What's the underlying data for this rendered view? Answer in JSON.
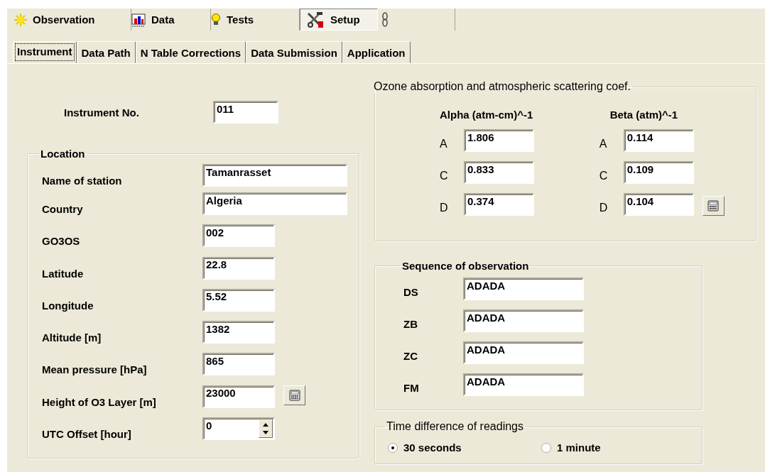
{
  "top_tabs": [
    {
      "label": "Observation",
      "selected": false
    },
    {
      "label": "Data",
      "selected": false
    },
    {
      "label": "Tests",
      "selected": false
    },
    {
      "label": "Setup",
      "selected": true
    },
    {
      "selected": false
    }
  ],
  "sub_tabs": [
    {
      "label": "Instrument",
      "selected": true
    },
    {
      "label": "Data Path",
      "selected": false
    },
    {
      "label": "N Table Corrections",
      "selected": false
    },
    {
      "label": "Data Submission",
      "selected": false
    },
    {
      "label": "Application",
      "selected": false
    }
  ],
  "instrument_no": {
    "label": "Instrument No.",
    "value": "011"
  },
  "location": {
    "title": "Location",
    "fields": [
      {
        "label": "Name of station",
        "value": "Tamanrasset",
        "kind": "wide"
      },
      {
        "label": "Country",
        "value": "Algeria",
        "kind": "wide"
      },
      {
        "label": "GO3OS",
        "value": "002",
        "kind": "text"
      },
      {
        "label": "Latitude",
        "value": "22.8",
        "kind": "text"
      },
      {
        "label": "Longitude",
        "value": "5.52",
        "kind": "text"
      },
      {
        "label": "Altitude [m]",
        "value": "1382",
        "kind": "text"
      },
      {
        "label": "Mean pressure [hPa]",
        "value": "865",
        "kind": "text"
      },
      {
        "label": "Height of O3 Layer [m]",
        "value": "23000",
        "kind": "calc"
      },
      {
        "label": "UTC Offset [hour]",
        "value": "0",
        "kind": "spin"
      }
    ]
  },
  "coefficients": {
    "title": "Ozone absorption and atmospheric scattering coef.",
    "columns": [
      {
        "heading": "Alpha (atm-cm)^-1",
        "rows": [
          {
            "label": "A",
            "value": "1.806",
            "kind": "text"
          },
          {
            "label": "C",
            "value": "0.833",
            "kind": "text"
          },
          {
            "label": "D",
            "value": "0.374",
            "kind": "text"
          }
        ]
      },
      {
        "heading": "Beta (atm)^-1",
        "rows": [
          {
            "label": "A",
            "value": "0.114",
            "kind": "text"
          },
          {
            "label": "C",
            "value": "0.109",
            "kind": "text"
          },
          {
            "label": "D",
            "value": "0.104",
            "kind": "calc"
          }
        ]
      }
    ]
  },
  "sequence": {
    "title": "Sequence of observation",
    "rows": [
      {
        "label": "DS",
        "value": "ADADA"
      },
      {
        "label": "ZB",
        "value": "ADADA"
      },
      {
        "label": "ZC",
        "value": "ADADA"
      },
      {
        "label": "FM",
        "value": "ADADA"
      }
    ]
  },
  "time_difference": {
    "title": "Time difference of readings",
    "options": [
      {
        "label": "30 seconds",
        "selected": true
      },
      {
        "label": "1 minute",
        "selected": false
      }
    ]
  }
}
